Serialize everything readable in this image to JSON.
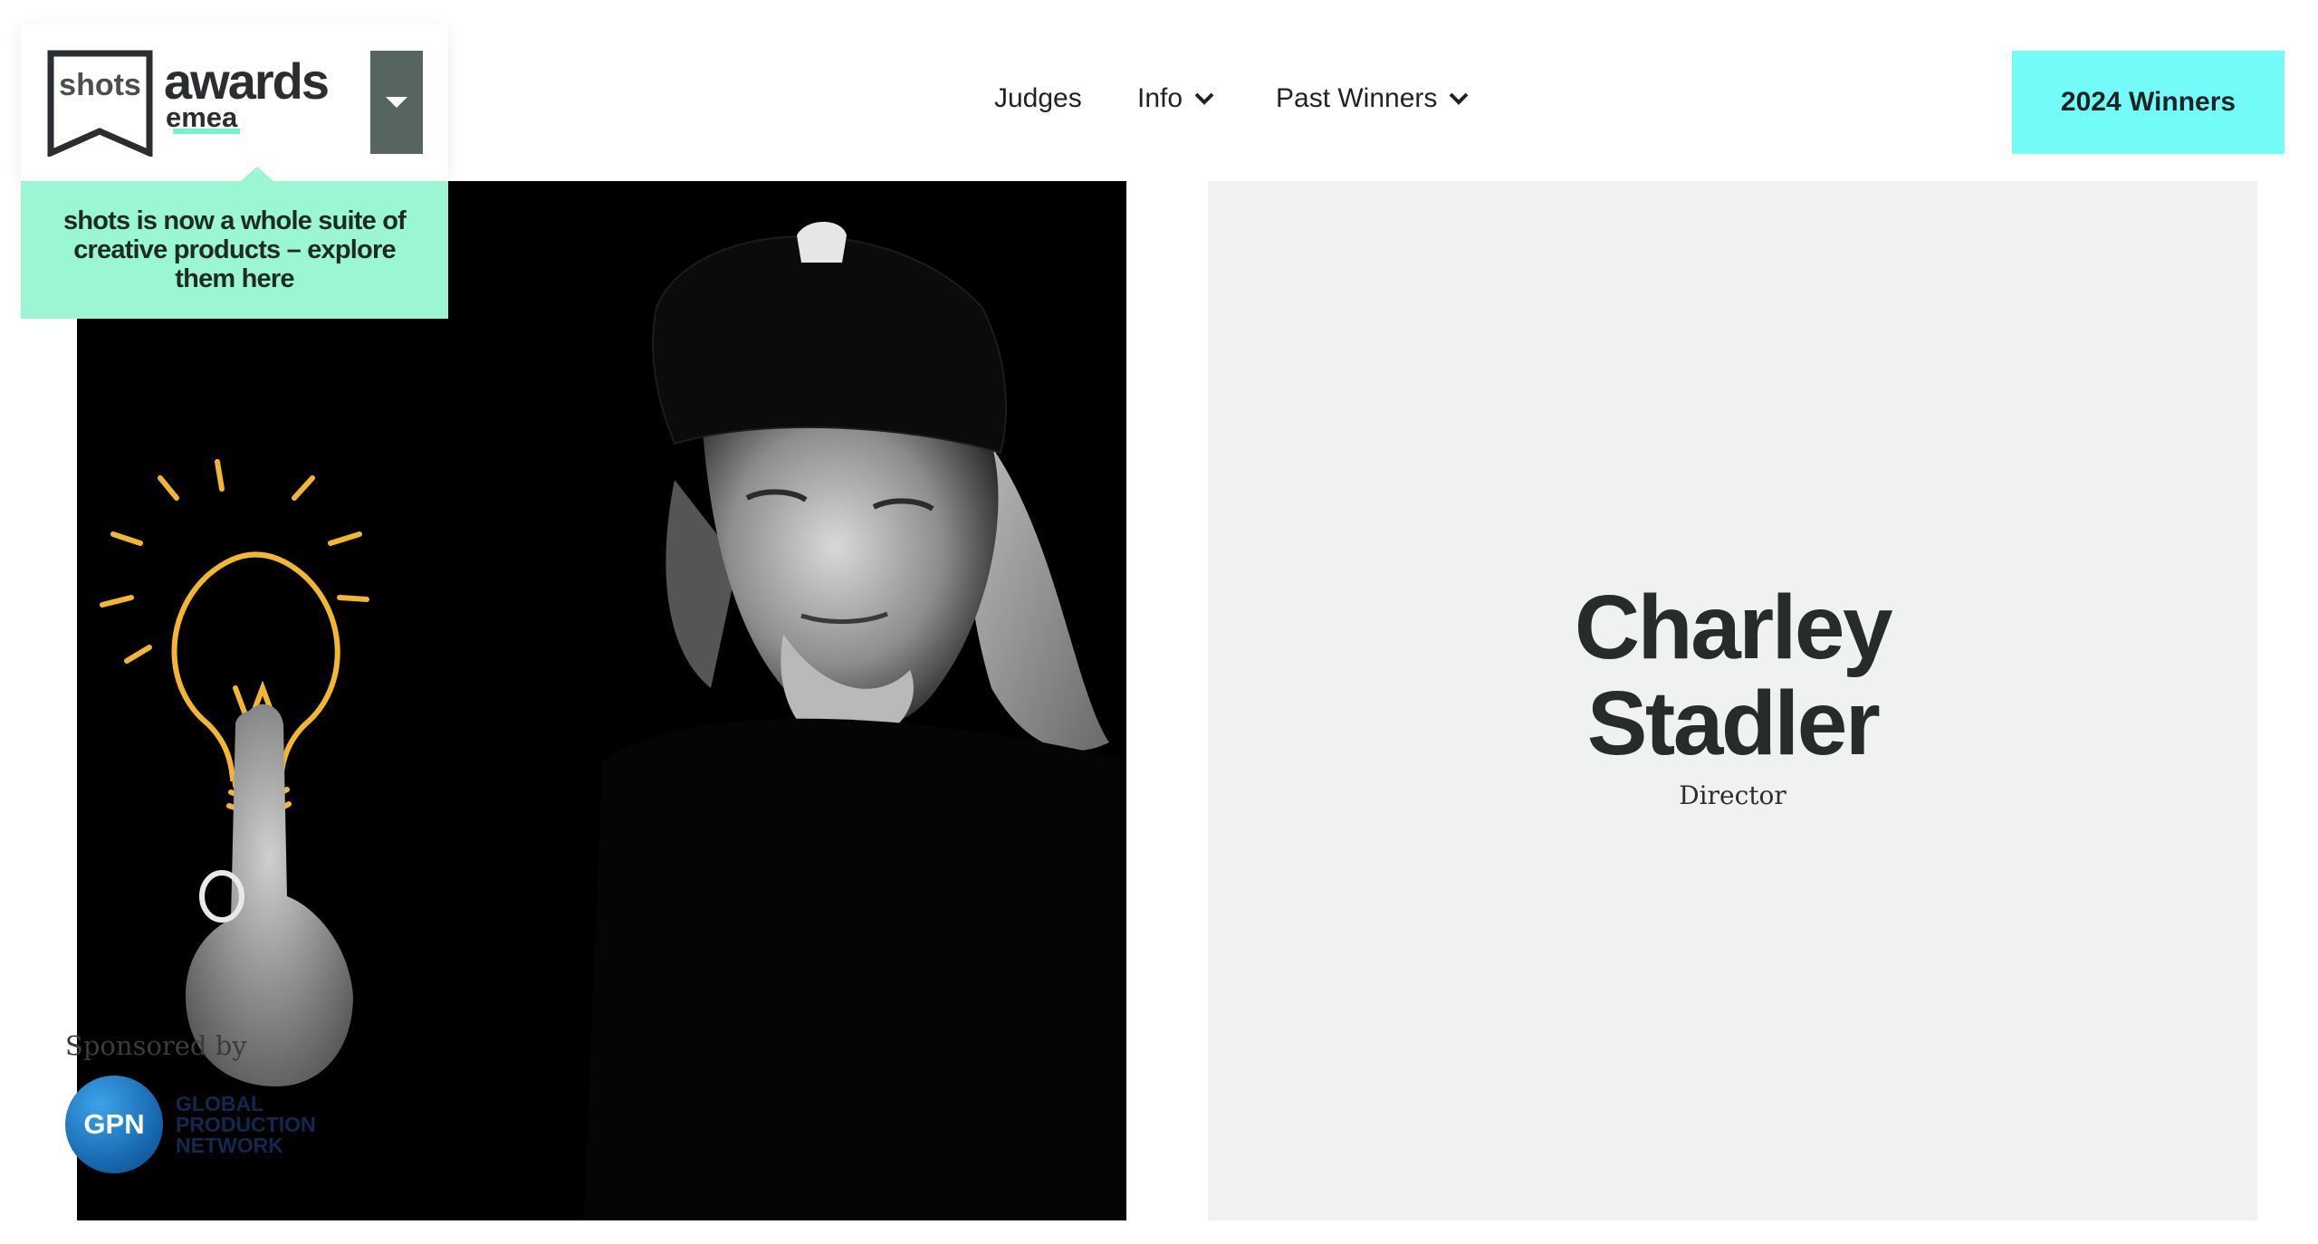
{
  "brand": {
    "logo_shots": "shots",
    "logo_awards": "awards",
    "logo_emea": "emea",
    "toggle_icon": "caret-down-icon",
    "promo_text": "shots is now a whole suite of creative products – explore them here",
    "promo_color": "#9bf6d4"
  },
  "nav": {
    "judges": "Judges",
    "info": "Info",
    "past_winners": "Past Winners",
    "cta": "2024 Winners",
    "cta_color": "#73fbf9"
  },
  "profile": {
    "name_line1": "Charley",
    "name_line2": "Stadler",
    "role": "Director"
  },
  "sponsor": {
    "label": "Sponsored by",
    "logo_initials": "GPN",
    "logo_words": [
      "GLOBAL",
      "PRODUCTION",
      "NETWORK"
    ]
  }
}
